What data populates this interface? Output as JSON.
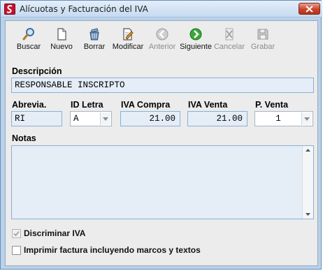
{
  "window": {
    "title": "Alícuotas y Facturación del IVA"
  },
  "toolbar": {
    "buttons": [
      {
        "label": "Buscar",
        "icon": "search-icon",
        "enabled": true
      },
      {
        "label": "Nuevo",
        "icon": "new-document-icon",
        "enabled": true
      },
      {
        "label": "Borrar",
        "icon": "delete-icon",
        "enabled": true
      },
      {
        "label": "Modificar",
        "icon": "edit-icon",
        "enabled": true
      },
      {
        "label": "Anterior",
        "icon": "previous-icon",
        "enabled": false
      },
      {
        "label": "Siguiente",
        "icon": "next-icon",
        "enabled": true
      },
      {
        "label": "Cancelar",
        "icon": "cancel-icon",
        "enabled": false
      },
      {
        "label": "Grabar",
        "icon": "save-icon",
        "enabled": false
      }
    ]
  },
  "form": {
    "descripcion": {
      "label": "Descripción",
      "value": "RESPONSABLE INSCRIPTO"
    },
    "abrevia": {
      "label": "Abrevia.",
      "value": "RI"
    },
    "id_letra": {
      "label": "ID Letra",
      "value": "A"
    },
    "iva_compra": {
      "label": "IVA Compra",
      "value": "21.00"
    },
    "iva_venta": {
      "label": "IVA Venta",
      "value": "21.00"
    },
    "p_venta": {
      "label": "P. Venta",
      "value": "1"
    },
    "notas": {
      "label": "Notas",
      "value": ""
    },
    "discriminar_iva": {
      "label": "Discriminar IVA",
      "checked": true,
      "enabled": false
    },
    "imprimir_factura": {
      "label": "Imprimir factura incluyendo marcos y textos",
      "checked": false,
      "enabled": true
    }
  },
  "colors": {
    "titlebar": "#c6daef",
    "client_bg": "#ececec",
    "field_bg": "#e5edf7",
    "field_border": "#8bb0d6",
    "close_button": "#c8442b"
  }
}
